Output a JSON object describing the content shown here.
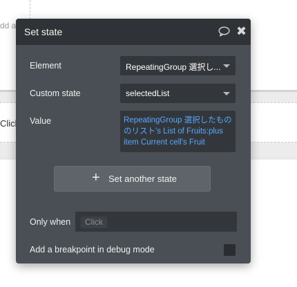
{
  "background": {
    "top_text": "dd a",
    "middle_text": "Click"
  },
  "popup": {
    "title": "Set state",
    "icons": {
      "comment": "speech-bubble-icon",
      "close": "close-icon"
    },
    "element": {
      "label": "Element",
      "value": "RepeatingGroup 選択し..."
    },
    "custom_state": {
      "label": "Custom state",
      "value": "selectedList"
    },
    "value": {
      "label": "Value",
      "expression": "RepeatingGroup 選択したもののリスト's List of Fruits:plus item Current cell's Fruit"
    },
    "add_state_button": {
      "label": "Set another state"
    },
    "only_when": {
      "label": "Only when",
      "placeholder": "Click"
    },
    "breakpoint": {
      "label": "Add a breakpoint in debug mode",
      "checked": false
    }
  },
  "colors": {
    "popup_bg": "#4a4f55",
    "header_bg": "#2f3337",
    "field_bg": "#33373b",
    "expression_text": "#5aa7ff"
  }
}
